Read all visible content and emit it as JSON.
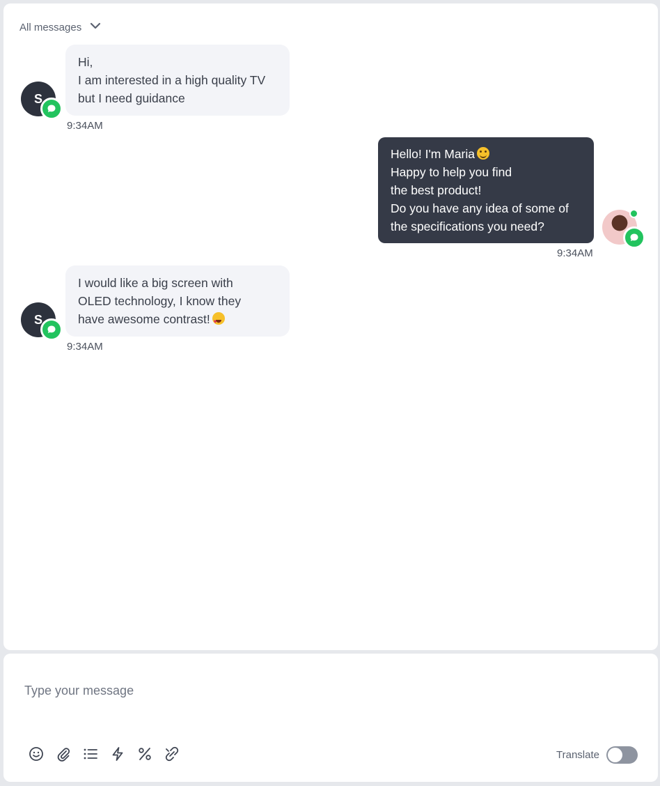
{
  "filter": {
    "label": "All messages"
  },
  "messages": [
    {
      "direction": "incoming",
      "avatar_initial": "S",
      "lines": [
        "Hi,",
        "I am interested in a high quality TV",
        "but I need guidance"
      ],
      "time": "9:34AM"
    },
    {
      "direction": "outgoing",
      "lines": [
        "Hello! I'm Maria",
        "Happy to help you find",
        "the best product!",
        "Do you have any idea of some of",
        "the specifications you need?"
      ],
      "emoji": "smiling-face-icon",
      "time": "9:34AM"
    },
    {
      "direction": "incoming",
      "avatar_initial": "S",
      "lines": [
        "I would like a big screen with",
        "OLED technology, I know they",
        "have awesome contrast!"
      ],
      "emoji": "heart-eyes-icon",
      "time": "9:34AM"
    }
  ],
  "compose": {
    "placeholder": "Type your message",
    "tools": [
      "emoji-icon",
      "attachment-icon",
      "list-icon",
      "lightning-icon",
      "percent-icon",
      "link-off-icon"
    ]
  },
  "translate": {
    "label": "Translate",
    "enabled": false
  },
  "colors": {
    "badge_green": "#22c35e",
    "outgoing_bubble": "#353a47",
    "incoming_bubble": "#f3f4f8",
    "toggle_off": "#8e94a0"
  }
}
